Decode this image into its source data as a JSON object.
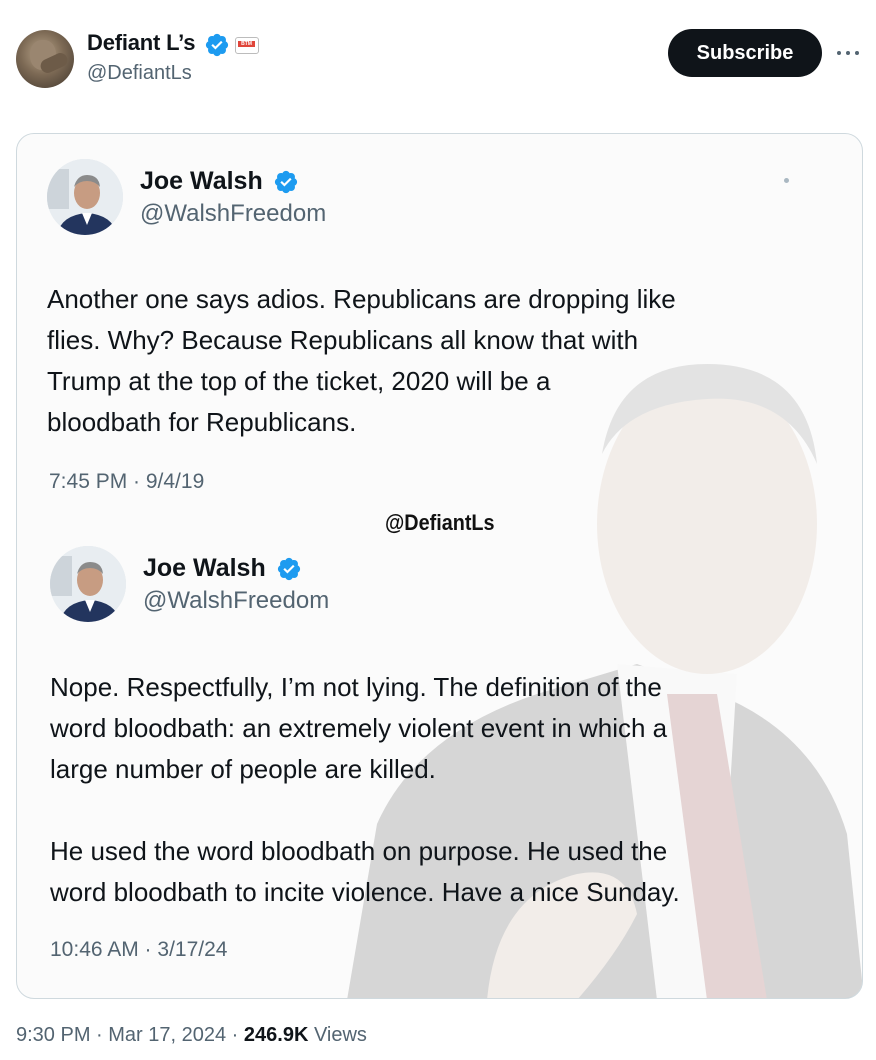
{
  "post": {
    "author_name": "Defiant L’s",
    "author_handle": "@DefiantLs",
    "subscribe_label": "Subscribe",
    "more_icon": "more-horizontal-icon",
    "verified_color": "#1d9bf0"
  },
  "card": {
    "watermark": "@DefiantLs",
    "quotes": [
      {
        "name": "Joe Walsh",
        "handle": "@WalshFreedom",
        "lines": [
          "Another one says adios. Republicans are dropping like",
          "flies. Why? Because Republicans all know that with",
          "Trump at the top of the ticket, 2020 will be a",
          "bloodbath for Republicans."
        ],
        "time": "7:45 PM · 9/4/19"
      },
      {
        "name": "Joe Walsh",
        "handle": "@WalshFreedom",
        "lines": [
          "Nope. Respectfully, I’m not lying. The definition of the",
          "word bloodbath: an extremely violent event in which a",
          "large number of people are killed.",
          "",
          "He used the word bloodbath on purpose. He used the",
          "word bloodbath to incite violence. Have a nice Sunday."
        ],
        "time": "10:46 AM · 3/17/24"
      }
    ]
  },
  "footer": {
    "time": "9:30 PM · Mar 17, 2024 · ",
    "views_count": "246.9K",
    "views_label": " Views"
  }
}
